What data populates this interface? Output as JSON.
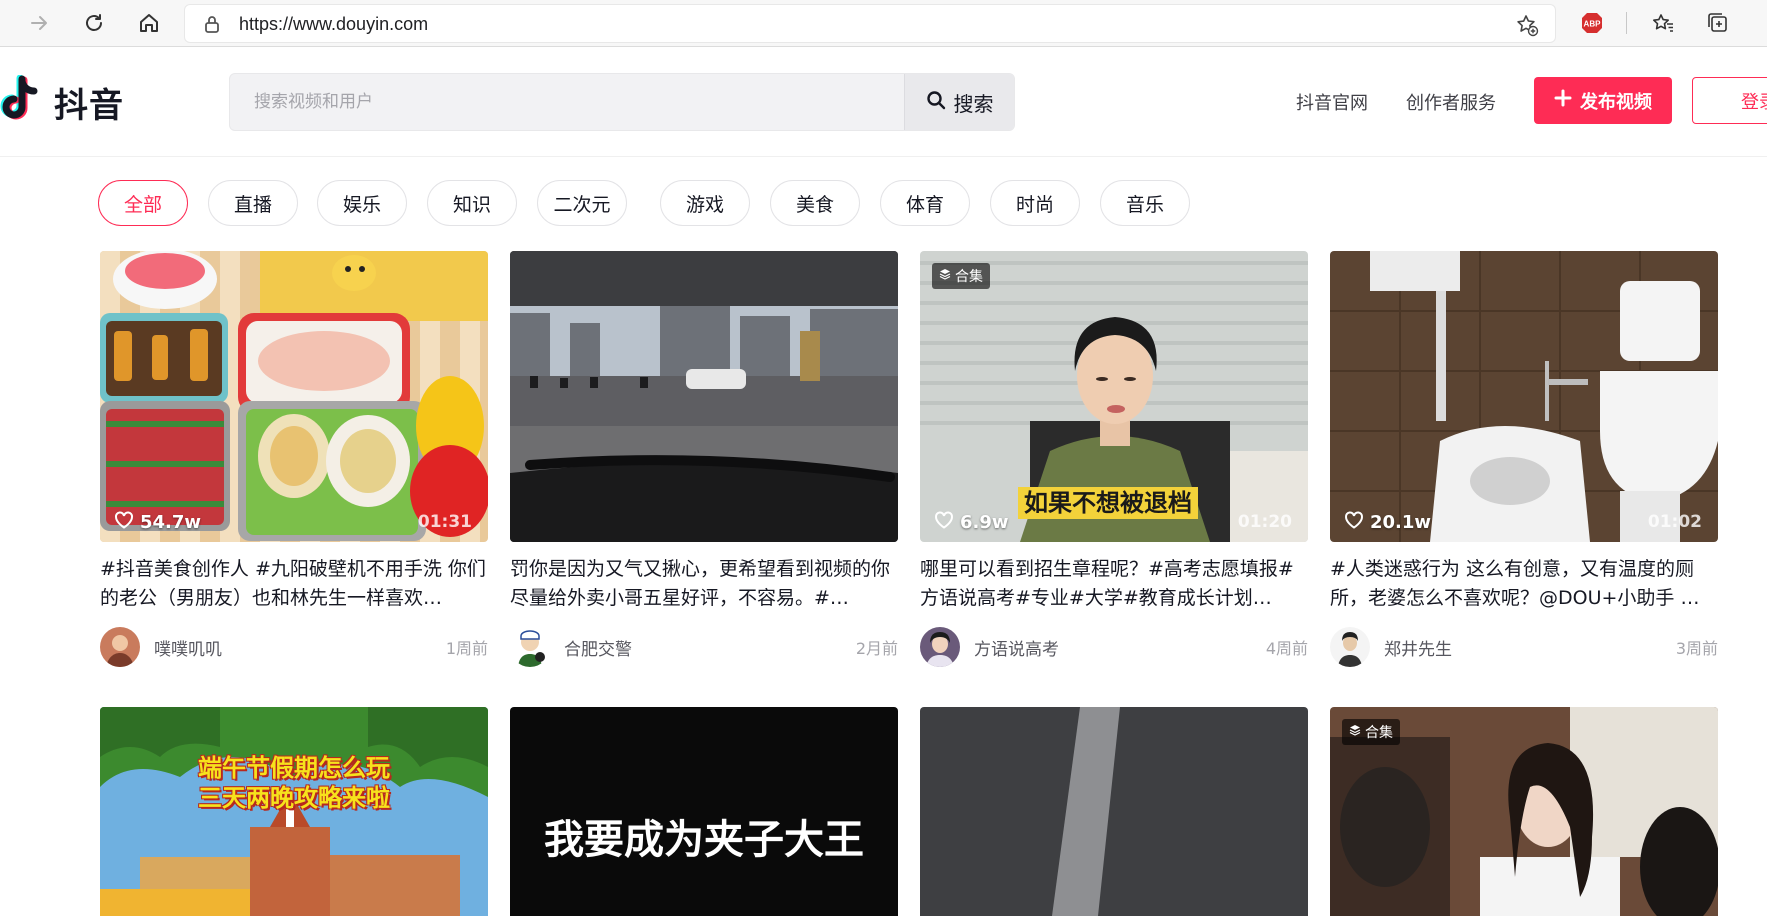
{
  "browser": {
    "url": "https://www.douyin.com",
    "adblock_label": "ABP"
  },
  "header": {
    "logo_text": "抖音",
    "search_placeholder": "搜索视频和用户",
    "search_button": "搜索",
    "links": [
      "抖音官网",
      "创作者服务"
    ],
    "publish_button": "发布视频",
    "login_button": "登录"
  },
  "categories": [
    "全部",
    "直播",
    "娱乐",
    "知识",
    "二次元",
    "游戏",
    "美食",
    "体育",
    "时尚",
    "音乐"
  ],
  "active_category": "全部",
  "videos": [
    {
      "badge": "",
      "likes": "54.7w",
      "duration": "01:31",
      "title": "#抖音美食创作人 #九阳破壁机不用手洗 你们的老公（男朋友）也和林先生一样喜欢…",
      "author": "噗噗叽叽",
      "time": "1周前"
    },
    {
      "badge": "",
      "likes": "",
      "duration": "",
      "title": "罚你是因为又气又揪心，更希望看到视频的你尽量给外卖小哥五星好评，不容易。#…",
      "author": "合肥交警",
      "time": "2月前"
    },
    {
      "badge": "合集",
      "likes": "6.9w",
      "duration": "01:20",
      "overlay": "如果不想被退档",
      "title": "哪里可以看到招生章程呢？#高考志愿填报#方语说高考#专业#大学#教育成长计划…",
      "author": "方语说高考",
      "time": "4周前"
    },
    {
      "badge": "",
      "likes": "20.1w",
      "duration": "01:02",
      "title": "#人类迷惑行为 这么有创意，又有温度的厕所，老婆怎么不喜欢呢？@DOU+小助手 …",
      "author": "郑井先生",
      "time": "3周前"
    },
    {
      "badge": "",
      "overlay_line1": "端午节假期怎么玩",
      "overlay_line2": "三天两晚攻略来啦"
    },
    {
      "badge": "",
      "overlay": "我要成为夹子大王"
    },
    {
      "badge": ""
    },
    {
      "badge": "合集"
    }
  ]
}
